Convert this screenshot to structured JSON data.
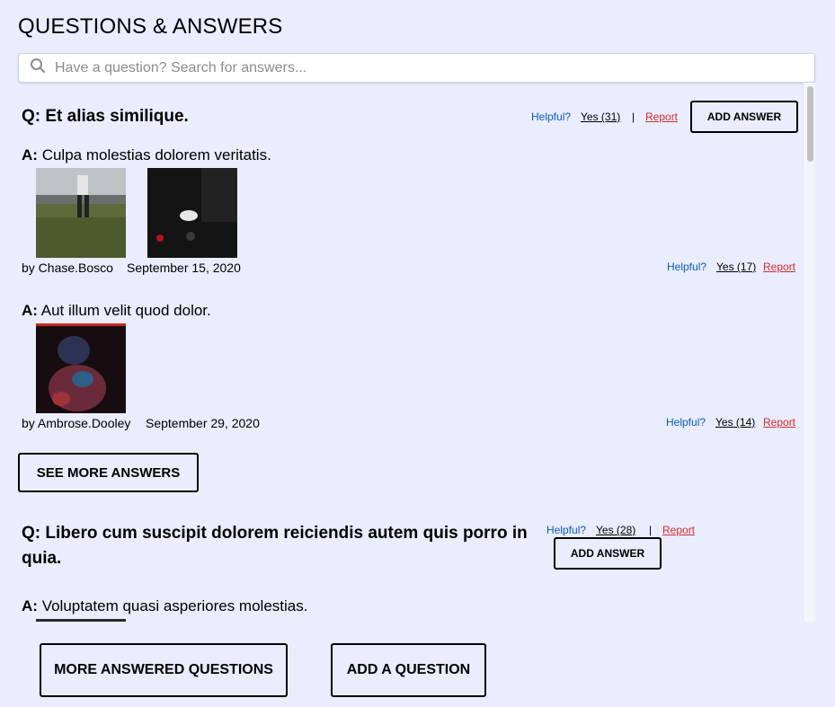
{
  "header": {
    "title": "QUESTIONS & ANSWERS"
  },
  "search": {
    "placeholder": "Have a question? Search for answers..."
  },
  "questions": [
    {
      "text": "Q: Et alias similique.",
      "helpful_label": "Helpful?",
      "yes_label": "Yes (31)",
      "separator": "|",
      "report_label": "Report",
      "add_answer_label": "ADD ANSWER",
      "answers": [
        {
          "prefix": "A:",
          "text": "Culpa molestias dolorem veritatis.",
          "user": "by Chase.Bosco",
          "date": "September 15, 2020",
          "helpful_label": "Helpful?",
          "yes_label": "Yes (17)",
          "report_label": "Report"
        },
        {
          "prefix": "A:",
          "text": "Aut illum velit quod dolor.",
          "user": "by Ambrose.Dooley",
          "date": "September 29, 2020",
          "helpful_label": "Helpful?",
          "yes_label": "Yes (14)",
          "report_label": "Report"
        }
      ],
      "see_more_label": "SEE MORE ANSWERS"
    },
    {
      "text": "Q: Libero cum suscipit dolorem reiciendis autem quis porro in quia.",
      "helpful_label": "Helpful?",
      "yes_label": "Yes (28)",
      "separator": "|",
      "report_label": "Report",
      "add_answer_label": "ADD ANSWER",
      "answers": [
        {
          "prefix": "A:",
          "text": "Voluptatem quasi asperiores molestias."
        }
      ]
    }
  ],
  "footer": {
    "more_questions_label": "MORE ANSWERED QUESTIONS",
    "add_question_label": "ADD A QUESTION"
  },
  "icons": {
    "search": "search-icon"
  },
  "colors": {
    "background": "#e9edfe",
    "helpful": "#0a5bc4",
    "report": "#d52b2b"
  }
}
